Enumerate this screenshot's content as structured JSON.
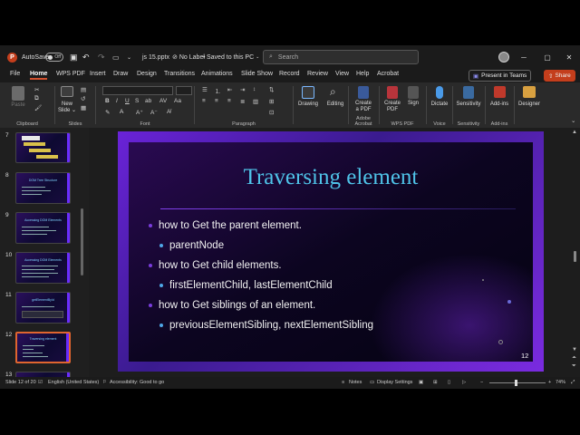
{
  "titlebar": {
    "autosave_label": "AutoSave",
    "autosave_state": "Off",
    "filename": "js 15.pptx",
    "label_status": "No Label",
    "save_status": "Saved to this PC",
    "search_placeholder": "Search"
  },
  "menu": {
    "items": [
      "File",
      "Home",
      "WPS PDF",
      "Insert",
      "Draw",
      "Design",
      "Transitions",
      "Animations",
      "Slide Show",
      "Record",
      "Review",
      "View",
      "Help",
      "Acrobat"
    ],
    "active": "Home",
    "present_label": "Present in Teams",
    "share_label": "Share"
  },
  "ribbon": {
    "paste_label": "Paste",
    "clipboard_label": "Clipboard",
    "new_slide_label1": "New",
    "new_slide_label2": "Slide",
    "slides_label": "Slides",
    "font_label": "Font",
    "paragraph_label": "Paragraph",
    "drawing_label": "Drawing",
    "editing_label": "Editing",
    "create_pdf_label1": "Create",
    "create_pdf_label2": "a PDF",
    "adobe_label": "Adobe Acrobat",
    "wps_create_label1": "Create",
    "wps_create_label2": "PDF",
    "sign_label": "Sign",
    "wps_label": "WPS PDF",
    "dictate_label": "Dictate",
    "voice_label": "Voice",
    "sensitivity_label": "Sensitivity",
    "sensitivity_group_label": "Sensitivity",
    "addins_label": "Add-ins",
    "addins_group_label": "Add-ins",
    "designer_label": "Designer"
  },
  "thumbnails": [
    {
      "num": "7",
      "title": ""
    },
    {
      "num": "8",
      "title": "DOM Tree Structure"
    },
    {
      "num": "9",
      "title": "Accessing DOM Elements"
    },
    {
      "num": "10",
      "title": "Accessing DOM Elements"
    },
    {
      "num": "11",
      "title": "getElementById"
    },
    {
      "num": "12",
      "title": "Traversing element"
    },
    {
      "num": "13",
      "title": ""
    }
  ],
  "slide": {
    "title": "Traversing element",
    "bullets": [
      {
        "level": 1,
        "text": "how to Get the parent element."
      },
      {
        "level": 2,
        "text": "parentNode"
      },
      {
        "level": 1,
        "text": "how to Get child elements."
      },
      {
        "level": 2,
        "text": "firstElementChild, lastElementChild"
      },
      {
        "level": 1,
        "text": "how to Get siblings of an element."
      },
      {
        "level": 2,
        "text": "previousElementSibling, nextElementSibling"
      }
    ],
    "number": "12"
  },
  "status": {
    "slide_info": "Slide 12 of 20",
    "language": "English (United States)",
    "accessibility": "Accessibility: Good to go",
    "notes": "Notes",
    "display_settings": "Display Settings",
    "zoom": "74%"
  },
  "colors": {
    "accent": "#c43e1c",
    "slide_title": "#4fc3e8",
    "active_thumb_border": "#e0652f"
  }
}
